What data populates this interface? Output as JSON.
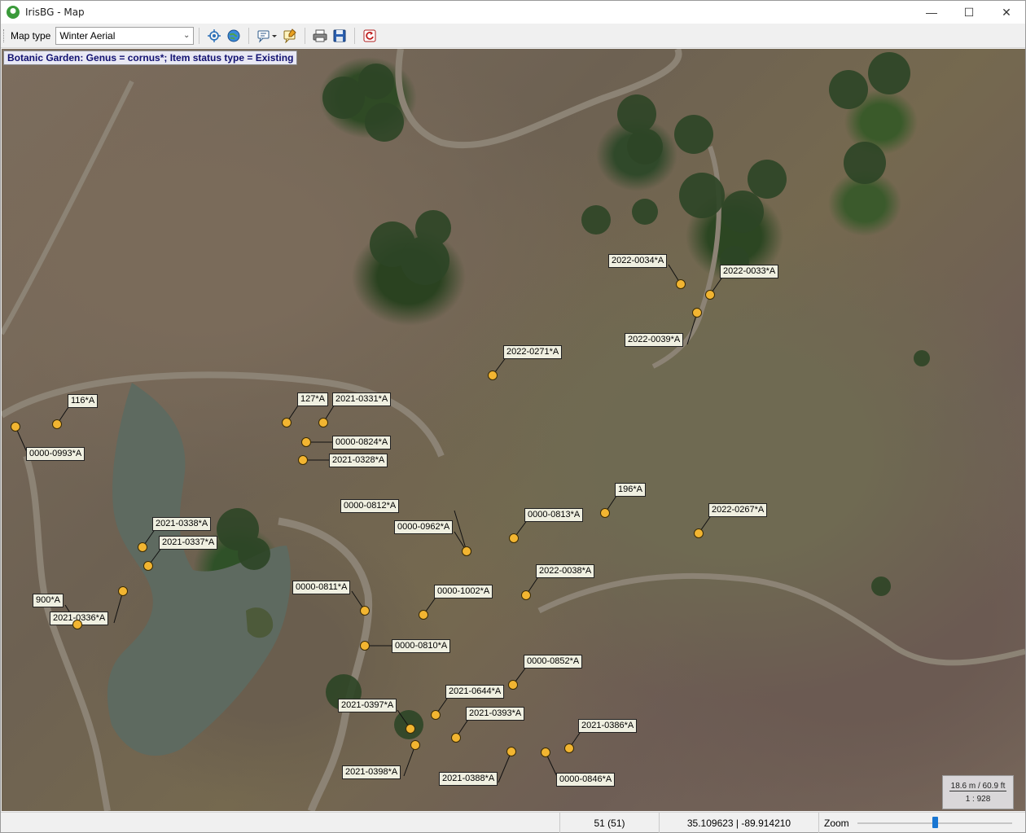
{
  "window": {
    "title": "IrisBG - Map",
    "controls": {
      "minimize": "—",
      "maximize": "☐",
      "close": "✕"
    }
  },
  "toolbar": {
    "map_type_label": "Map type",
    "map_type_value": "Winter Aerial",
    "buttons": [
      "locate-icon",
      "globe-icon",
      "comment-dropdown-icon",
      "note-icon",
      "print-icon",
      "save-icon",
      "reset-icon"
    ]
  },
  "map": {
    "filter_label": "Botanic Garden: Genus = cornus*; Item status type = Existing",
    "callouts": [
      {
        "text": "2022-0034*A"
      },
      {
        "text": "2022-0033*A"
      },
      {
        "text": "2022-0039*A"
      },
      {
        "text": "2022-0271*A"
      },
      {
        "text": "116*A"
      },
      {
        "text": "127*A"
      },
      {
        "text": "2021-0331*A"
      },
      {
        "text": "0000-0993*A"
      },
      {
        "text": "0000-0824*A"
      },
      {
        "text": "2021-0328*A"
      },
      {
        "text": "196*A"
      },
      {
        "text": "0000-0812*A"
      },
      {
        "text": "0000-0962*A"
      },
      {
        "text": "0000-0813*A"
      },
      {
        "text": "2022-0267*A"
      },
      {
        "text": "2021-0338*A"
      },
      {
        "text": "2021-0337*A"
      },
      {
        "text": "2022-0038*A"
      },
      {
        "text": "0000-0811*A"
      },
      {
        "text": "0000-1002*A"
      },
      {
        "text": "900*A"
      },
      {
        "text": "2021-0336*A"
      },
      {
        "text": "0000-0810*A"
      },
      {
        "text": "0000-0852*A"
      },
      {
        "text": "2021-0644*A"
      },
      {
        "text": "2021-0397*A"
      },
      {
        "text": "2021-0393*A"
      },
      {
        "text": "2021-0386*A"
      },
      {
        "text": "2021-0398*A"
      },
      {
        "text": "2021-0388*A"
      },
      {
        "text": "0000-0846*A"
      }
    ],
    "scale": {
      "distance": "18.6 m / 60.9 ft",
      "ratio": "1 : 928"
    },
    "marker_color": "#f2b531"
  },
  "statusbar": {
    "count": "51 (51)",
    "coords": "35.109623 | -89.914210",
    "zoom_label": "Zoom",
    "zoom_level": 0.49
  }
}
